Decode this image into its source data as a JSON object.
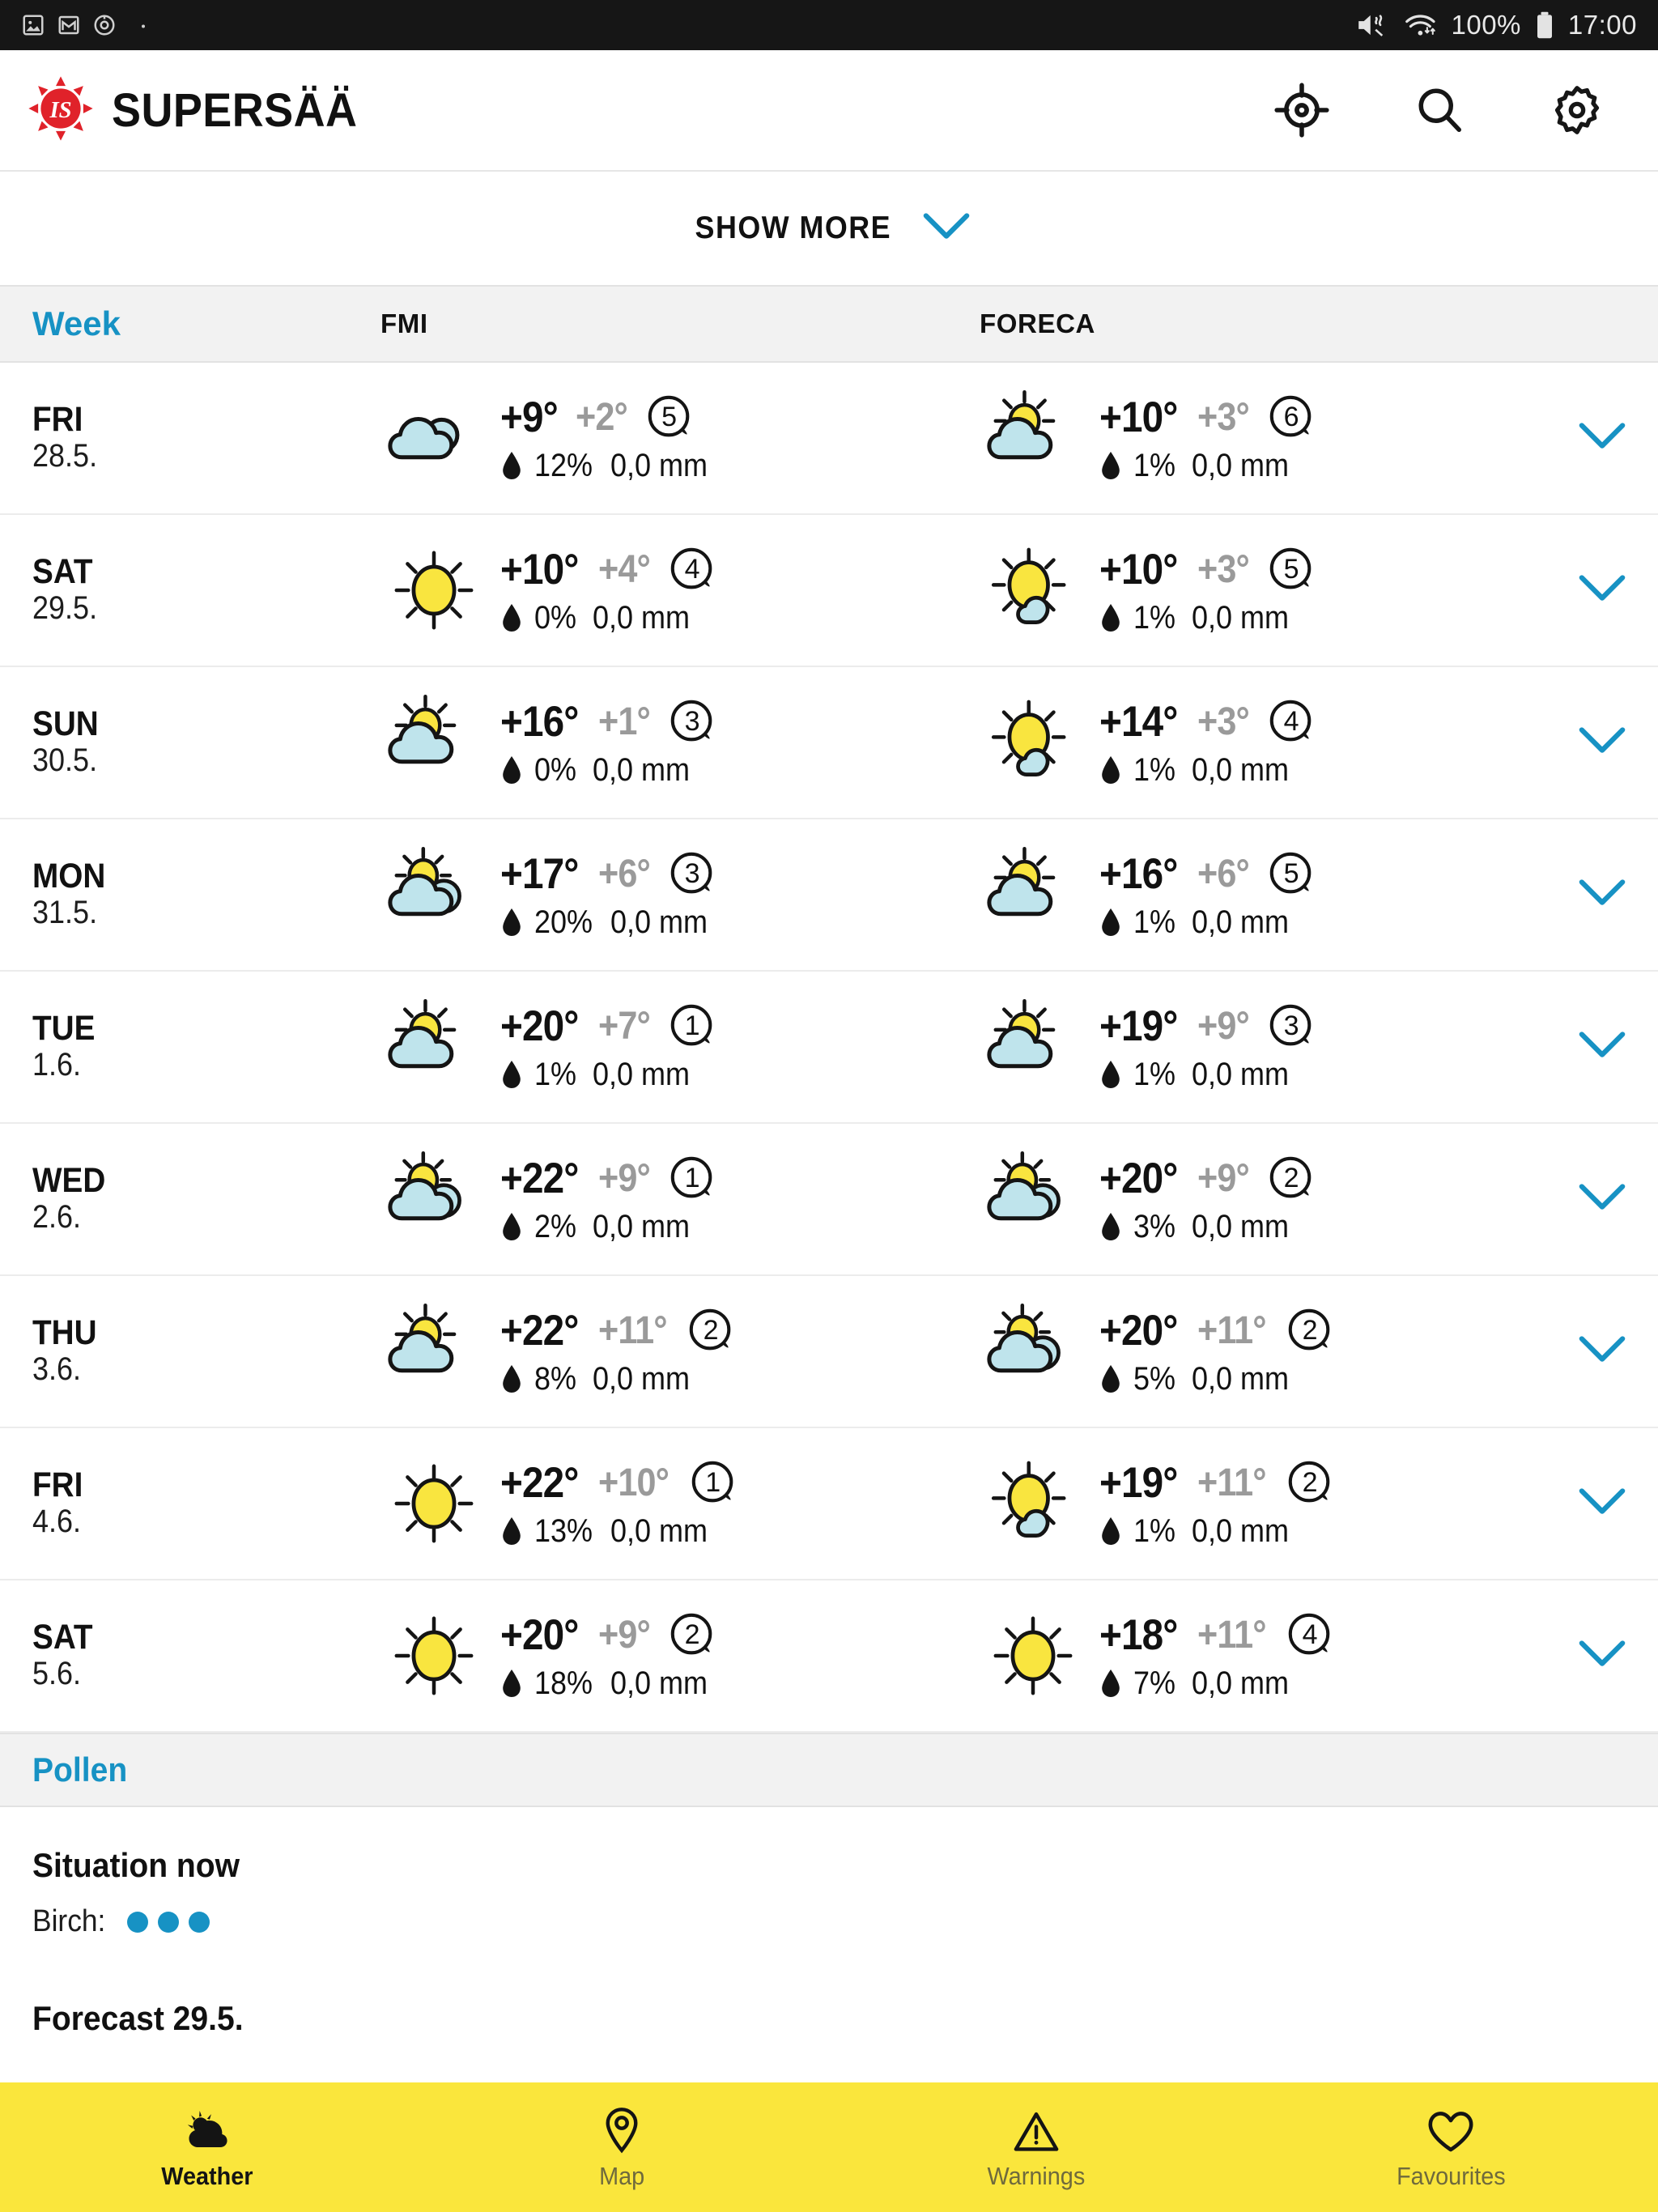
{
  "status_bar": {
    "left_icons": [
      "image-icon",
      "mail-icon",
      "clock-icon",
      "dot-icon"
    ],
    "mute_icon": "mute-icon",
    "wifi_icon": "wifi-icon",
    "battery_percent": "100%",
    "battery_icon": "battery-icon",
    "time": "17:00"
  },
  "app_header": {
    "logo_icon": "is-sun-logo-icon",
    "logo_text": "IS",
    "title": "SUPERSÄÄ",
    "actions": [
      {
        "name": "locate-icon",
        "label": "Locate"
      },
      {
        "name": "search-icon",
        "label": "Search"
      },
      {
        "name": "gear-icon",
        "label": "Settings"
      }
    ]
  },
  "show_more": {
    "label": "SHOW MORE",
    "chevron_icon": "chevron-down-icon"
  },
  "table": {
    "headers": {
      "week": "Week",
      "fmi": "FMI",
      "foreca": "FORECA"
    },
    "rows": [
      {
        "day": "FRI",
        "date": "28.5.",
        "fmi": {
          "icon": "cloudy",
          "tmax": "+9°",
          "tmin": "+2°",
          "wind": "5",
          "pop": "12%",
          "precip": "0,0 mm"
        },
        "foreca": {
          "icon": "partly-cloudy",
          "tmax": "+10°",
          "tmin": "+3°",
          "wind": "6",
          "pop": "1%",
          "precip": "0,0 mm"
        }
      },
      {
        "day": "SAT",
        "date": "29.5.",
        "fmi": {
          "icon": "sunny",
          "tmax": "+10°",
          "tmin": "+4°",
          "wind": "4",
          "pop": "0%",
          "precip": "0,0 mm"
        },
        "foreca": {
          "icon": "sunny-small-cloud",
          "tmax": "+10°",
          "tmin": "+3°",
          "wind": "5",
          "pop": "1%",
          "precip": "0,0 mm"
        }
      },
      {
        "day": "SUN",
        "date": "30.5.",
        "fmi": {
          "icon": "partly-cloudy",
          "tmax": "+16°",
          "tmin": "+1°",
          "wind": "3",
          "pop": "0%",
          "precip": "0,0 mm"
        },
        "foreca": {
          "icon": "sunny-small-cloud",
          "tmax": "+14°",
          "tmin": "+3°",
          "wind": "4",
          "pop": "1%",
          "precip": "0,0 mm"
        }
      },
      {
        "day": "MON",
        "date": "31.5.",
        "fmi": {
          "icon": "partly-cloudy-double",
          "tmax": "+17°",
          "tmin": "+6°",
          "wind": "3",
          "pop": "20%",
          "precip": "0,0 mm"
        },
        "foreca": {
          "icon": "partly-cloudy",
          "tmax": "+16°",
          "tmin": "+6°",
          "wind": "5",
          "pop": "1%",
          "precip": "0,0 mm"
        }
      },
      {
        "day": "TUE",
        "date": "1.6.",
        "fmi": {
          "icon": "partly-cloudy",
          "tmax": "+20°",
          "tmin": "+7°",
          "wind": "1",
          "pop": "1%",
          "precip": "0,0 mm"
        },
        "foreca": {
          "icon": "partly-cloudy",
          "tmax": "+19°",
          "tmin": "+9°",
          "wind": "3",
          "pop": "1%",
          "precip": "0,0 mm"
        }
      },
      {
        "day": "WED",
        "date": "2.6.",
        "fmi": {
          "icon": "partly-cloudy-double",
          "tmax": "+22°",
          "tmin": "+9°",
          "wind": "1",
          "pop": "2%",
          "precip": "0,0 mm"
        },
        "foreca": {
          "icon": "partly-cloudy-double",
          "tmax": "+20°",
          "tmin": "+9°",
          "wind": "2",
          "pop": "3%",
          "precip": "0,0 mm"
        }
      },
      {
        "day": "THU",
        "date": "3.6.",
        "fmi": {
          "icon": "partly-cloudy",
          "tmax": "+22°",
          "tmin": "+11°",
          "wind": "2",
          "pop": "8%",
          "precip": "0,0 mm"
        },
        "foreca": {
          "icon": "partly-cloudy-double",
          "tmax": "+20°",
          "tmin": "+11°",
          "wind": "2",
          "pop": "5%",
          "precip": "0,0 mm"
        }
      },
      {
        "day": "FRI",
        "date": "4.6.",
        "fmi": {
          "icon": "sunny",
          "tmax": "+22°",
          "tmin": "+10°",
          "wind": "1",
          "pop": "13%",
          "precip": "0,0 mm"
        },
        "foreca": {
          "icon": "sunny-small-cloud",
          "tmax": "+19°",
          "tmin": "+11°",
          "wind": "2",
          "pop": "1%",
          "precip": "0,0 mm"
        }
      },
      {
        "day": "SAT",
        "date": "5.6.",
        "fmi": {
          "icon": "sunny",
          "tmax": "+20°",
          "tmin": "+9°",
          "wind": "2",
          "pop": "18%",
          "precip": "0,0 mm"
        },
        "foreca": {
          "icon": "sunny",
          "tmax": "+18°",
          "tmin": "+11°",
          "wind": "4",
          "pop": "7%",
          "precip": "0,0 mm"
        }
      }
    ],
    "expand_icon": "chevron-down-icon"
  },
  "pollen": {
    "section_title": "Pollen",
    "situation_heading": "Situation now",
    "species_label": "Birch:",
    "level_dots": 3,
    "forecast_heading": "Forecast 29.5."
  },
  "bottom_nav": {
    "items": [
      {
        "label": "Weather",
        "icon": "sun-cloud-icon",
        "active": true
      },
      {
        "label": "Map",
        "icon": "map-pin-icon",
        "active": false
      },
      {
        "label": "Warnings",
        "icon": "warning-triangle-icon",
        "active": false
      },
      {
        "label": "Favourites",
        "icon": "heart-icon",
        "active": false
      }
    ]
  },
  "colors": {
    "accent_blue": "#1792c4",
    "nav_yellow": "#fae63c",
    "cloud_fill": "#bfe4ec",
    "sun_fill": "#f9e53f",
    "logo_red": "#e0222a",
    "muted_gray": "#9a9a9a"
  }
}
